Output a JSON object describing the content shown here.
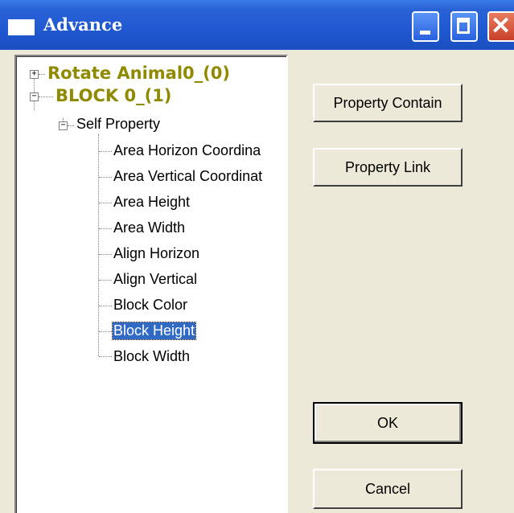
{
  "window": {
    "title": "Advance",
    "controls": {
      "minimize": "minimize-icon",
      "maximize": "maximize-icon",
      "close": "close-icon"
    }
  },
  "tree": {
    "roots": [
      {
        "label": "Rotate Animal0_(0)",
        "expanded": false
      },
      {
        "label": "BLOCK 0_(1)",
        "expanded": true
      }
    ],
    "group": {
      "label": "Self Property",
      "expanded": true
    },
    "leaves": [
      "Area Horizon Coordina",
      "Area Vertical Coordinat",
      "Area Height",
      "Area Width",
      "Align Horizon",
      "Align Vertical",
      "Block Color",
      "Block Height",
      "Block Width"
    ],
    "selected_leaf": "Block Height"
  },
  "buttons": {
    "property_contain": "Property Contain",
    "property_link": "Property Link",
    "ok": "OK",
    "cancel": "Cancel"
  },
  "colors": {
    "titlebar": "#1f58d1",
    "root_text": "#8f8a00",
    "selection": "#316ac5",
    "dialog_bg": "#ece9d8"
  }
}
